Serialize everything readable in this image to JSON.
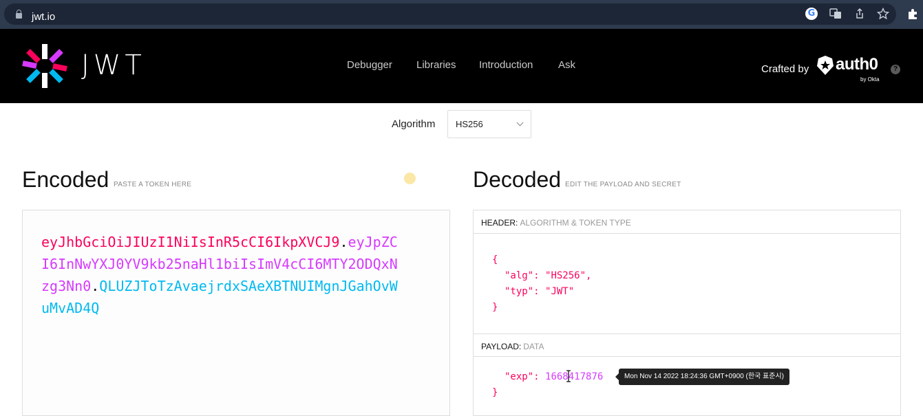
{
  "browser": {
    "url": "jwt.io",
    "icons": [
      "lock-icon",
      "google-icon",
      "translate-icon",
      "share-icon",
      "star-icon",
      "extensions-icon"
    ]
  },
  "header": {
    "wordmark": "JWT",
    "nav": [
      "Debugger",
      "Libraries",
      "Introduction",
      "Ask"
    ],
    "crafted_by": "Crafted by",
    "auth0": "auth0",
    "by_okta": "by Okta",
    "help": "?"
  },
  "algorithm": {
    "label": "Algorithm",
    "value": "HS256"
  },
  "encoded": {
    "title": "Encoded",
    "subtitle": "PASTE A TOKEN HERE",
    "header_part": "eyJhbGciOiJIUzI1NiIsInR5cCI6IkpXVCJ9",
    "payload_part": "eyJpZCI6InNwYXJ0YV9kb25naHl1biIsImV4cCI6MTY2ODQxNzg3Nn0",
    "signature_part": "QLUZJToTzAvaejrdxSAeXBTNUIMgnJGahOvWuMvAD4Q"
  },
  "decoded": {
    "title": "Decoded",
    "subtitle": "EDIT THE PAYLOAD AND SECRET",
    "header_label": "HEADER:",
    "header_sub": "ALGORITHM & TOKEN TYPE",
    "header_json": {
      "open": "{",
      "alg_key": "\"alg\"",
      "alg_val": "\"HS256\"",
      "typ_key": "\"typ\"",
      "typ_val": "\"JWT\"",
      "close": "}"
    },
    "payload_label": "PAYLOAD:",
    "payload_sub": "DATA",
    "payload_json": {
      "exp_key": "\"exp\"",
      "exp_val": "1668417876",
      "close": "}"
    },
    "tooltip": "Mon Nov 14 2022 18:24:36 GMT+0900 (한국 표준시)"
  }
}
